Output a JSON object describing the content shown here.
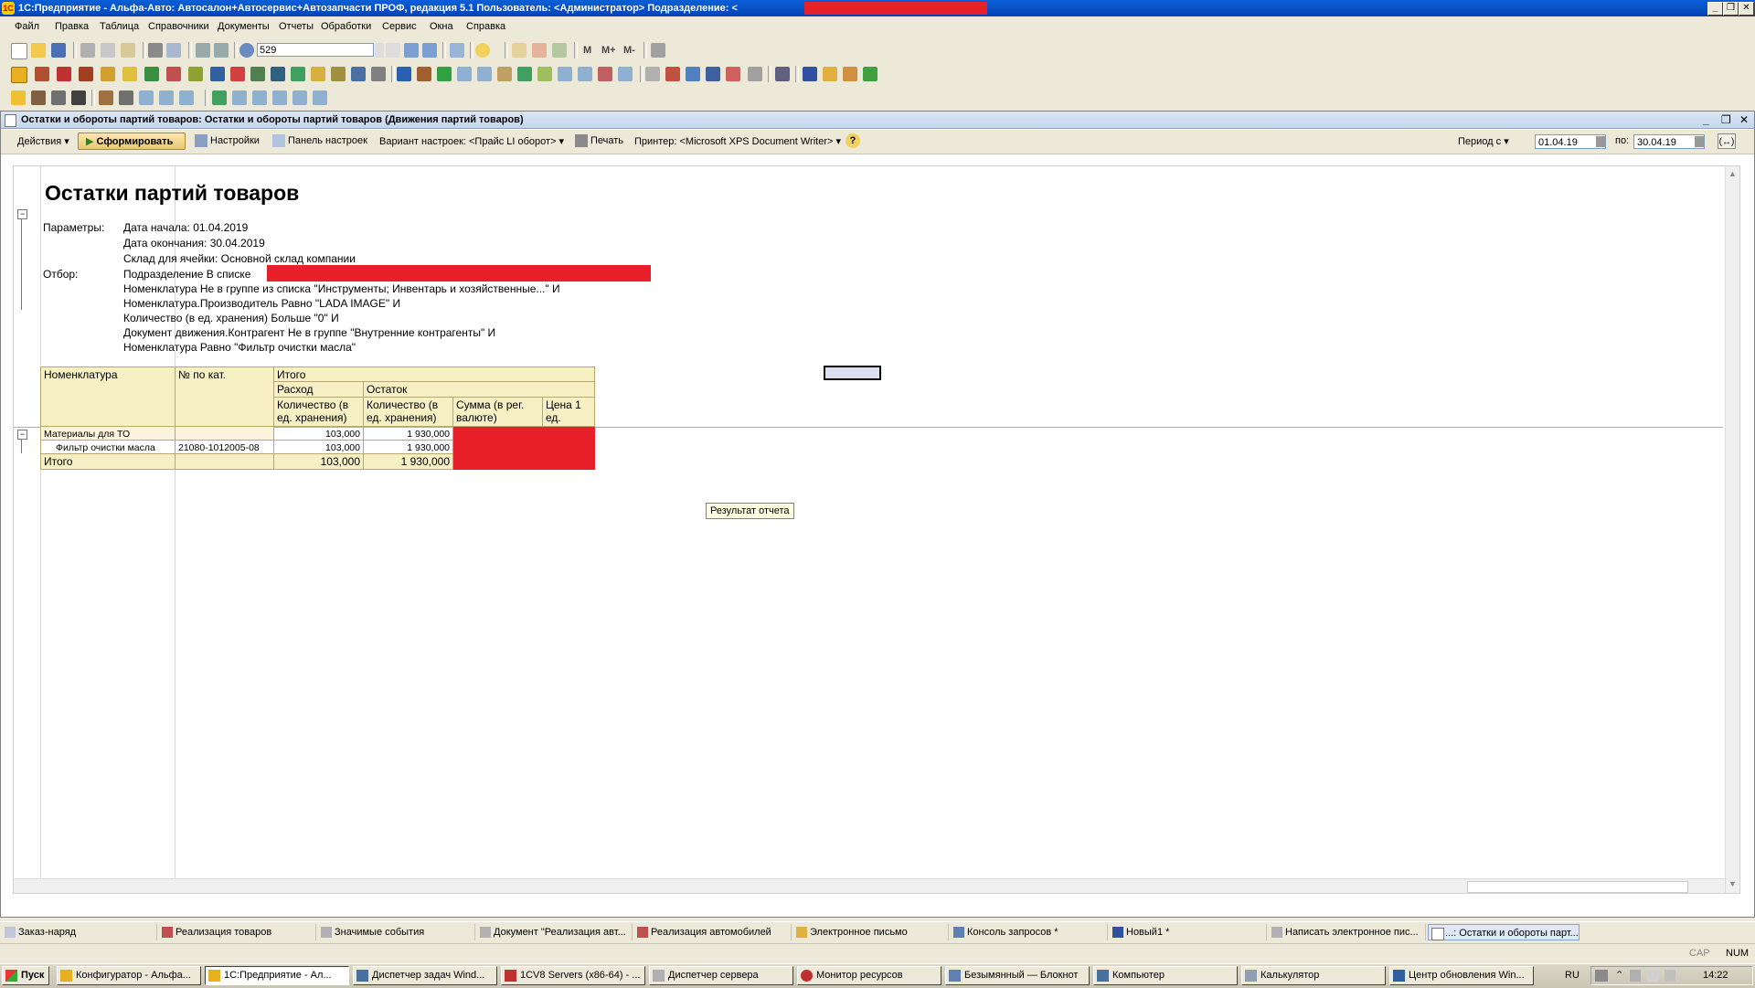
{
  "titlebar": {
    "title": "1С:Предприятие - Альфа-Авто: Автосалон+Автосервис+Автозапчасти ПРОФ, редакция 5.1    Пользователь: <Администратор>    Подразделение: <",
    "minimize": "_",
    "restore": "❐",
    "close": "✕"
  },
  "menu": {
    "file": "Файл",
    "edit": "Правка",
    "table": "Таблица",
    "refs": "Справочники",
    "docs": "Документы",
    "reports": "Отчеты",
    "processing": "Обработки",
    "service": "Сервис",
    "windows": "Окна",
    "help": "Справка"
  },
  "toolbar": {
    "search_value": "529",
    "m": "M",
    "m_plus": "M+",
    "m_minus": "M-"
  },
  "doc": {
    "title": "Остатки и обороты партий товаров: Остатки и обороты партий товаров (Движения партий товаров)",
    "actions": "Действия",
    "generate": "Сформировать",
    "settings": "Настройки",
    "settings_panel": "Панель настроек",
    "variant": "Вариант настроек: <Прайс LI оборот>",
    "print": "Печать",
    "printer": "Принтер: <Microsoft XPS Document Writer>",
    "period": "Период с",
    "date_from": "01.04.19",
    "to_label": "по:",
    "date_to": "30.04.19"
  },
  "report": {
    "heading": "Остатки партий товаров",
    "params_label": "Параметры:",
    "param_lines": [
      "Дата начала: 01.04.2019",
      "Дата окончания: 30.04.2019",
      "Склад для ячейки: Основной склад компании"
    ],
    "filter_label": "Отбор:",
    "filter_lines": [
      "Подразделение В списке",
      "Номенклатура Не в группе из списка \"Инструменты; Инвентарь и хозяйственные...\" И",
      "Номенклатура.Производитель Равно \"LADA IMAGE\" И",
      "Количество (в ед. хранения) Больше \"0\" И",
      "Документ движения.Контрагент Не в группе \"Внутренние контрагенты\" И",
      "Номенклатура Равно \"Фильтр очистки масла\""
    ],
    "table": {
      "h_nomenclature": "Номенклатура",
      "h_catno": "№ по кат.",
      "h_total": "Итого",
      "h_expense": "Расход",
      "h_balance": "Остаток",
      "h_qty1": "Количество (в ед. хранения)",
      "h_qty2": "Количество (в ед. хранения)",
      "h_sum": "Сумма (в рег. валюте)",
      "h_price": "Цена 1 ед.",
      "rows": [
        {
          "name": "Материалы для ТО",
          "cat": "",
          "expense": "103,000",
          "balance": "1 930,000"
        },
        {
          "name": "Фильтр очистки масла",
          "cat": "21080-1012005-08",
          "expense": "103,000",
          "balance": "1 930,000"
        },
        {
          "name": "Итого",
          "cat": "",
          "expense": "103,000",
          "balance": "1 930,000"
        }
      ]
    },
    "tooltip": "Результат отчета"
  },
  "window_tabs": [
    "Заказ-наряд",
    "Реализация товаров",
    "Значимые события",
    "Документ \"Реализация авт...",
    "Реализация автомобилей",
    "Электронное письмо",
    "Консоль запросов *",
    "Новый1 *",
    "Написать электронное пис...",
    "...: Остатки и обороты парт..."
  ],
  "status": {
    "cap": "CAP",
    "num": "NUM"
  },
  "taskbar": {
    "start": "Пуск",
    "items": [
      "Конфигуратор - Альфа...",
      "1С:Предприятие - Ал...",
      "Диспетчер задач Wind...",
      "1CV8 Servers (x86-64) - ...",
      "Диспетчер сервера",
      "Монитор ресурсов",
      "Безымянный — Блокнот",
      "Компьютер",
      "Калькулятор",
      "Центр обновления Win..."
    ],
    "lang": "RU",
    "time": "14:22"
  },
  "colors": {
    "redaction": "#e8202a",
    "header_fill": "#f6f0c4",
    "title_blue": "#0a5fd8"
  }
}
